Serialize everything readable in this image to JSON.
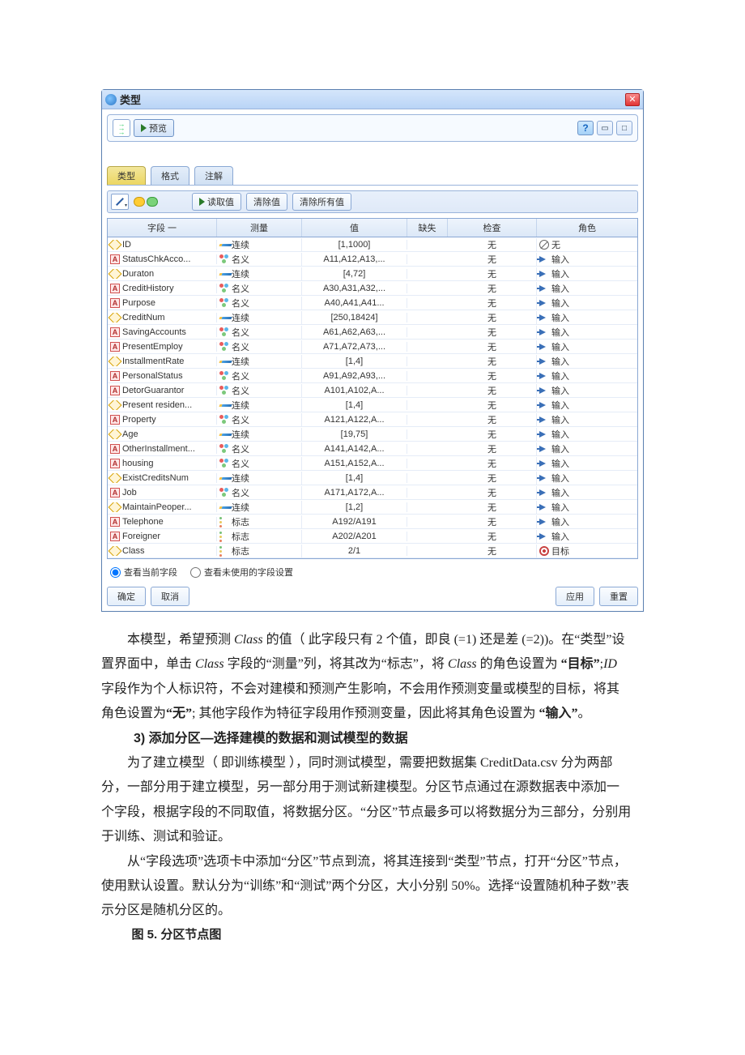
{
  "window": {
    "title": "类型",
    "preview_label": "预览"
  },
  "tabs": [
    "类型",
    "格式",
    "注解"
  ],
  "toolbar": {
    "read_values": "读取值",
    "clear_values": "清除值",
    "clear_all": "清除所有值"
  },
  "grid": {
    "headers": [
      "字段 一",
      "测量",
      "值",
      "缺失",
      "检查",
      "角色"
    ],
    "rows": [
      {
        "field": "ID",
        "ftype": "n",
        "measure": "连续",
        "mtype": "cont",
        "value": "[1,1000]",
        "check": "无",
        "role": "无",
        "rtype": "none"
      },
      {
        "field": "StatusChkAcco...",
        "ftype": "a",
        "measure": "名义",
        "mtype": "nom",
        "value": "A11,A12,A13,...",
        "check": "无",
        "role": "输入",
        "rtype": "in"
      },
      {
        "field": "Duraton",
        "ftype": "n",
        "measure": "连续",
        "mtype": "cont",
        "value": "[4,72]",
        "check": "无",
        "role": "输入",
        "rtype": "in"
      },
      {
        "field": "CreditHistory",
        "ftype": "a",
        "measure": "名义",
        "mtype": "nom",
        "value": "A30,A31,A32,...",
        "check": "无",
        "role": "输入",
        "rtype": "in"
      },
      {
        "field": "Purpose",
        "ftype": "a",
        "measure": "名义",
        "mtype": "nom",
        "value": "A40,A41,A41...",
        "check": "无",
        "role": "输入",
        "rtype": "in"
      },
      {
        "field": "CreditNum",
        "ftype": "n",
        "measure": "连续",
        "mtype": "cont",
        "value": "[250,18424]",
        "check": "无",
        "role": "输入",
        "rtype": "in"
      },
      {
        "field": "SavingAccounts",
        "ftype": "a",
        "measure": "名义",
        "mtype": "nom",
        "value": "A61,A62,A63,...",
        "check": "无",
        "role": "输入",
        "rtype": "in"
      },
      {
        "field": "PresentEmploy",
        "ftype": "a",
        "measure": "名义",
        "mtype": "nom",
        "value": "A71,A72,A73,...",
        "check": "无",
        "role": "输入",
        "rtype": "in"
      },
      {
        "field": "InstallmentRate",
        "ftype": "n",
        "measure": "连续",
        "mtype": "cont",
        "value": "[1,4]",
        "check": "无",
        "role": "输入",
        "rtype": "in"
      },
      {
        "field": "PersonalStatus",
        "ftype": "a",
        "measure": "名义",
        "mtype": "nom",
        "value": "A91,A92,A93,...",
        "check": "无",
        "role": "输入",
        "rtype": "in"
      },
      {
        "field": "DetorGuarantor",
        "ftype": "a",
        "measure": "名义",
        "mtype": "nom",
        "value": "A101,A102,A...",
        "check": "无",
        "role": "输入",
        "rtype": "in"
      },
      {
        "field": "Present residen...",
        "ftype": "n",
        "measure": "连续",
        "mtype": "cont",
        "value": "[1,4]",
        "check": "无",
        "role": "输入",
        "rtype": "in"
      },
      {
        "field": "Property",
        "ftype": "a",
        "measure": "名义",
        "mtype": "nom",
        "value": "A121,A122,A...",
        "check": "无",
        "role": "输入",
        "rtype": "in"
      },
      {
        "field": "Age",
        "ftype": "n",
        "measure": "连续",
        "mtype": "cont",
        "value": "[19,75]",
        "check": "无",
        "role": "输入",
        "rtype": "in"
      },
      {
        "field": "OtherInstallment...",
        "ftype": "a",
        "measure": "名义",
        "mtype": "nom",
        "value": "A141,A142,A...",
        "check": "无",
        "role": "输入",
        "rtype": "in"
      },
      {
        "field": "housing",
        "ftype": "a",
        "measure": "名义",
        "mtype": "nom",
        "value": "A151,A152,A...",
        "check": "无",
        "role": "输入",
        "rtype": "in"
      },
      {
        "field": "ExistCreditsNum",
        "ftype": "n",
        "measure": "连续",
        "mtype": "cont",
        "value": "[1,4]",
        "check": "无",
        "role": "输入",
        "rtype": "in"
      },
      {
        "field": "Job",
        "ftype": "a",
        "measure": "名义",
        "mtype": "nom",
        "value": "A171,A172,A...",
        "check": "无",
        "role": "输入",
        "rtype": "in"
      },
      {
        "field": "MaintainPeoper...",
        "ftype": "n",
        "measure": "连续",
        "mtype": "cont",
        "value": "[1,2]",
        "check": "无",
        "role": "输入",
        "rtype": "in"
      },
      {
        "field": "Telephone",
        "ftype": "a",
        "measure": "标志",
        "mtype": "flag",
        "value": "A192/A191",
        "check": "无",
        "role": "输入",
        "rtype": "in"
      },
      {
        "field": "Foreigner",
        "ftype": "a",
        "measure": "标志",
        "mtype": "flag",
        "value": "A202/A201",
        "check": "无",
        "role": "输入",
        "rtype": "in"
      },
      {
        "field": "Class",
        "ftype": "n",
        "measure": "标志",
        "mtype": "flag",
        "value": "2/1",
        "check": "无",
        "role": "目标",
        "rtype": "tgt"
      }
    ]
  },
  "radios": {
    "view_current": "查看当前字段",
    "view_unused": "查看未使用的字段设置"
  },
  "buttons": {
    "ok": "确定",
    "cancel": "取消",
    "apply": "应用",
    "reset": "重置"
  },
  "paragraphs": {
    "p1a": "本模型，希望预测 ",
    "p1_class": "Class",
    "p1b": " 的值（ 此字段只有 2 个值，即良 (=1) 还是差 (=2))。在“类型”设置界面中，单击 ",
    "p1_class2": "Class",
    "p1c": " 字段的“测量”列，将其改为“标志”，将 ",
    "p1_class3": "Class",
    "p1d": " 的角色设置为 ",
    "p1_target": "“目标”",
    "p1e": ";",
    "p1_id": "ID",
    "p1f": " 字段作为个人标识符，不会对建模和预测产生影响，不会用作预测变量或模型的目标，将其角色设置为",
    "p1_none": "“无”",
    "p1g": "; 其他字段作为特征字段用作预测变量，因此将其角色设置为 ",
    "p1_input": "“输入”",
    "p1h": "。",
    "heading3": "3) 添加分区—选择建模的数据和测试模型的数据",
    "p2": "为了建立模型（ 即训练模型 ），同时测试模型，需要把数据集 CreditData.csv 分为两部分，一部分用于建立模型，另一部分用于测试新建模型。分区节点通过在源数据表中添加一个字段，根据字段的不同取值，将数据分区。“分区”节点最多可以将数据分为三部分，分别用于训练、测试和验证。",
    "p3": "从“字段选项”选项卡中添加“分区”节点到流，将其连接到“类型”节点，打开“分区”节点，使用默认设置。默认分为“训练”和“测试”两个分区，大小分别 50%。选择“设置随机种子数”表示分区是随机分区的。",
    "figcap": "图 5. 分区节点图"
  }
}
